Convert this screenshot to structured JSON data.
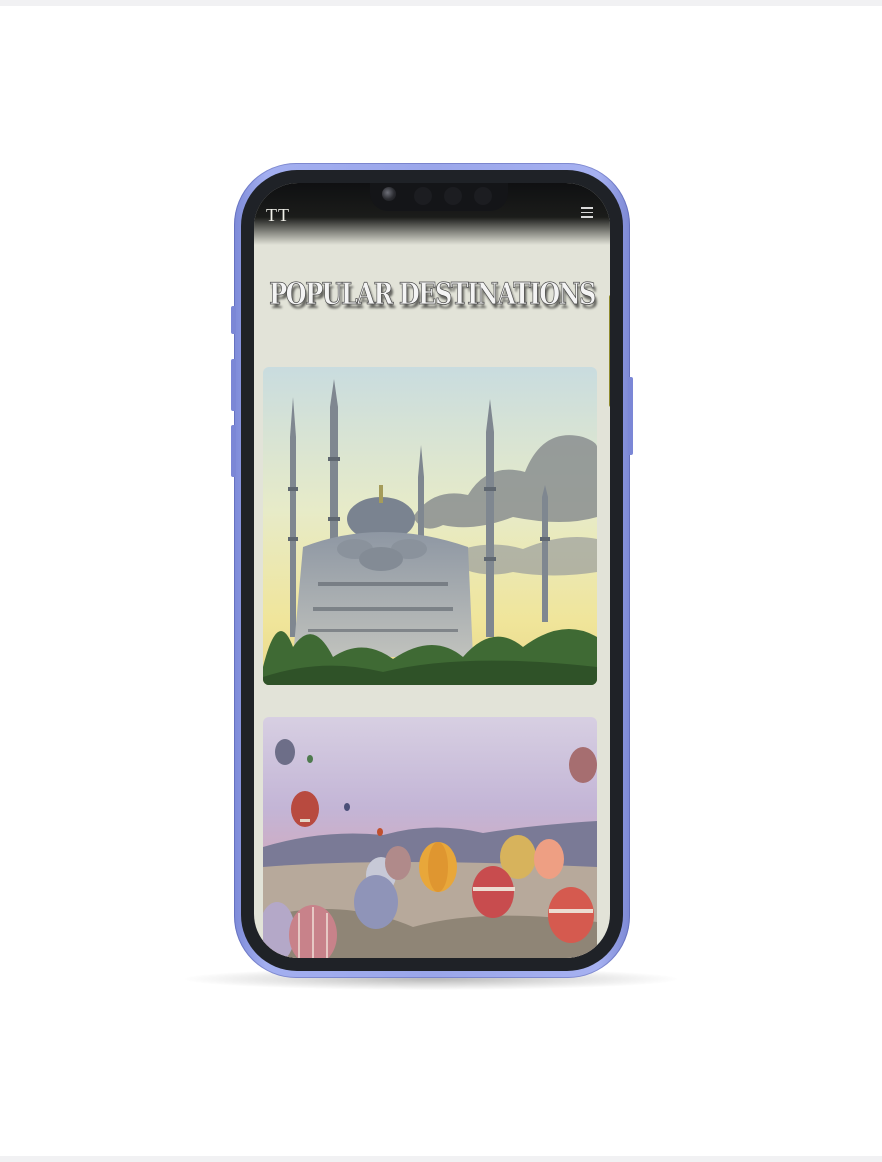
{
  "app": {
    "logo": "TT",
    "menu_icon": "hamburger-menu-icon"
  },
  "page": {
    "title": "POPULAR DESTINATIONS"
  },
  "destinations": [
    {
      "image_icon": "mosque-image"
    },
    {
      "image_icon": "hot-air-balloons-image"
    }
  ],
  "colors": {
    "phone_frame": "#9aa6ea",
    "screen_background": "#e2e3d8",
    "scrollbar": "#8f8a2c"
  }
}
